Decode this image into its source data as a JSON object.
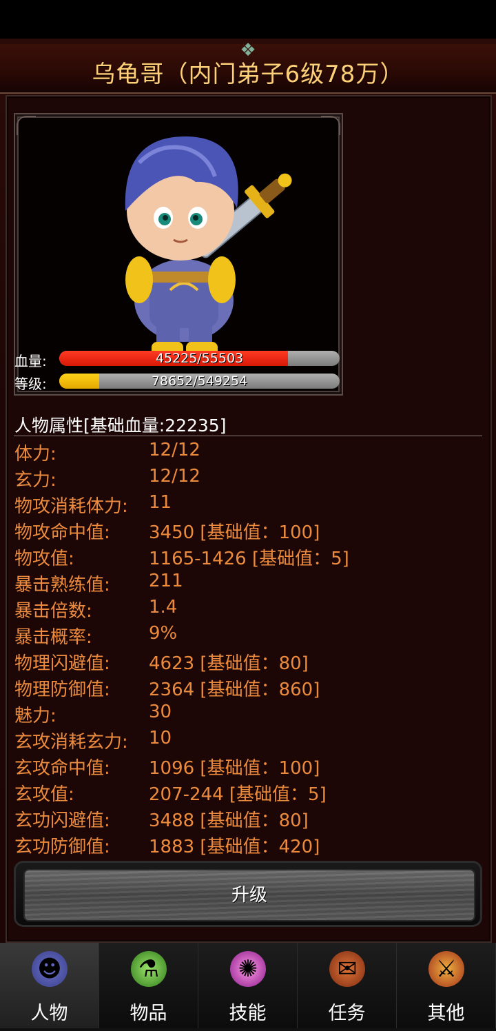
{
  "header": {
    "title": "乌龟哥（内门弟子6级78万）"
  },
  "status": {
    "hp_label": "血量:",
    "hp_text": "45225/55503",
    "hp_fraction": 0.815,
    "level_label": "等级:",
    "level_text": "78652/549254",
    "level_fraction": 0.143
  },
  "attributes": {
    "title": "人物属性[基础血量:22235]",
    "rows": [
      {
        "label": "体力:",
        "value": "12/12"
      },
      {
        "label": "玄力:",
        "value": "12/12"
      },
      {
        "label": "物攻消耗体力:",
        "value": "11"
      },
      {
        "label": "物攻命中值:",
        "value": "3450 [基础值：100]"
      },
      {
        "label": "物攻值:",
        "value": "1165-1426 [基础值：5]"
      },
      {
        "label": "暴击熟练值:",
        "value": "211"
      },
      {
        "label": "暴击倍数:",
        "value": "1.4"
      },
      {
        "label": "暴击概率:",
        "value": "9%"
      },
      {
        "label": "物理闪避值:",
        "value": "4623 [基础值：80]"
      },
      {
        "label": "物理防御值:",
        "value": "2364 [基础值：860]"
      },
      {
        "label": "魅力:",
        "value": "30"
      },
      {
        "label": "玄攻消耗玄力:",
        "value": "10"
      },
      {
        "label": "玄攻命中值:",
        "value": "1096 [基础值：100]"
      },
      {
        "label": "玄攻值:",
        "value": "207-244 [基础值：5]"
      },
      {
        "label": "玄功闪避值:",
        "value": "3488 [基础值：80]"
      },
      {
        "label": "玄功防御值:",
        "value": "1883 [基础值：420]"
      }
    ]
  },
  "actions": {
    "upgrade_label": "升级"
  },
  "nav": {
    "tabs": [
      {
        "label": "人物",
        "icon": "character-icon",
        "active": true
      },
      {
        "label": "物品",
        "icon": "potion-icon",
        "active": false
      },
      {
        "label": "技能",
        "icon": "skill-orb-icon",
        "active": false
      },
      {
        "label": "任务",
        "icon": "quest-scroll-icon",
        "active": false
      },
      {
        "label": "其他",
        "icon": "settings-emblem-icon",
        "active": false
      }
    ]
  },
  "colors": {
    "title": "#ffcf7a",
    "attribute_text": "#ec8b3d",
    "hp_bar": "#e52a12",
    "level_bar": "#f2c000"
  }
}
